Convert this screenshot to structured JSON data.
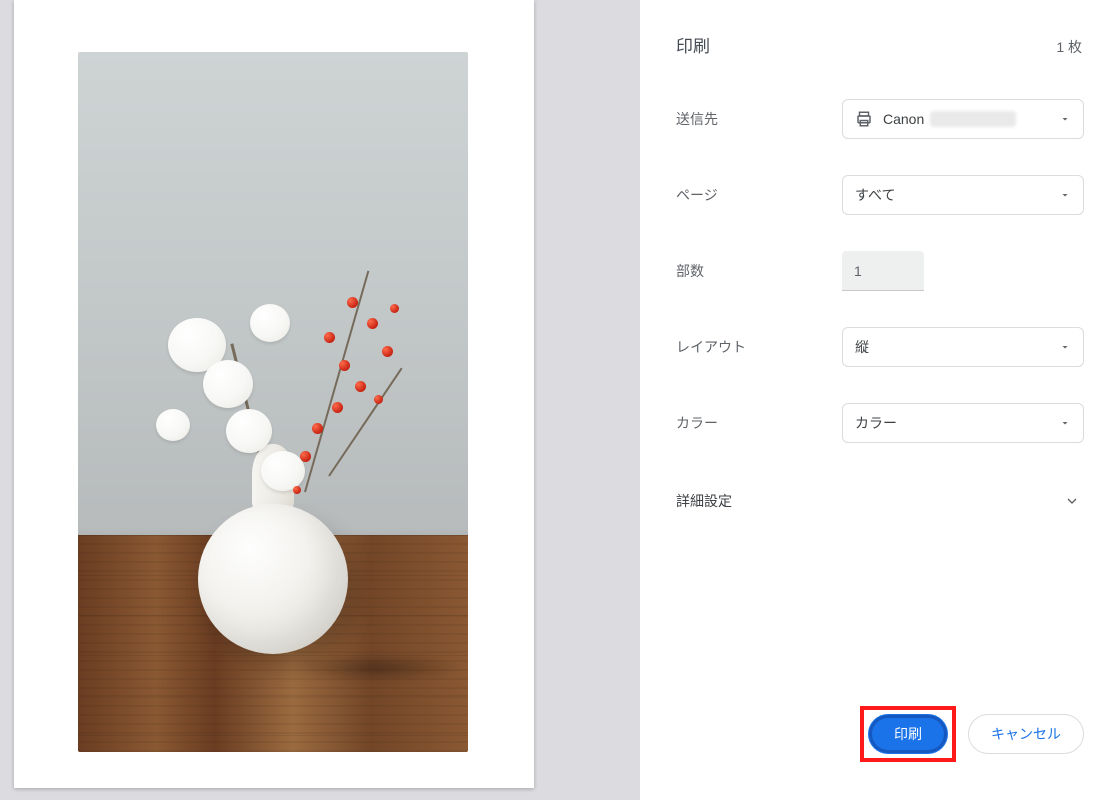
{
  "header": {
    "title": "印刷",
    "count": "1 枚"
  },
  "fields": {
    "destination": {
      "label": "送信先",
      "printer_brand": "Canon"
    },
    "pages": {
      "label": "ページ",
      "value": "すべて"
    },
    "copies": {
      "label": "部数",
      "value": "1"
    },
    "layout": {
      "label": "レイアウト",
      "value": "縦"
    },
    "color": {
      "label": "カラー",
      "value": "カラー"
    }
  },
  "advanced": {
    "label": "詳細設定"
  },
  "footer": {
    "print": "印刷",
    "cancel": "キャンセル"
  }
}
